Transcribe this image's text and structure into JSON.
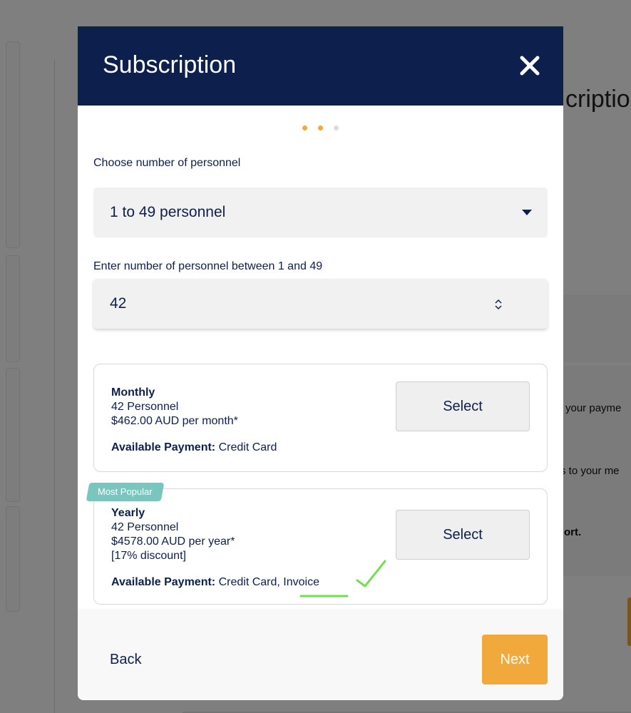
{
  "background": {
    "title_partial": "criptio",
    "line1": "your payme",
    "line2": "s to your me",
    "line3": "ort."
  },
  "modal": {
    "title": "Subscription",
    "close_icon": "close-icon",
    "steps": {
      "total": 3,
      "current": 2
    },
    "personnel_label": "Choose number of personnel",
    "personnel_select_value": "1 to 49 personnel",
    "number_label": "Enter number of personnel between 1 and 49",
    "number_value": "42",
    "plans": [
      {
        "name": "Monthly",
        "personnel": "42 Personnel",
        "price": "$462.00 AUD per month*",
        "payment_label": "Available Payment:",
        "payment_methods": "Credit Card",
        "select_label": "Select"
      },
      {
        "badge": "Most Popular",
        "name": "Yearly",
        "personnel": "42 Personnel",
        "price": "$4578.00 AUD per year*",
        "discount": "[17% discount]",
        "payment_label": "Available Payment:",
        "payment_methods": "Credit Card, Invoice",
        "select_label": "Select"
      }
    ],
    "back_label": "Back",
    "next_label": "Next"
  },
  "colors": {
    "header_bg": "#0d1f4d",
    "accent": "#f2a93b",
    "badge": "#78c6bd",
    "annotation": "#6ee04a"
  }
}
